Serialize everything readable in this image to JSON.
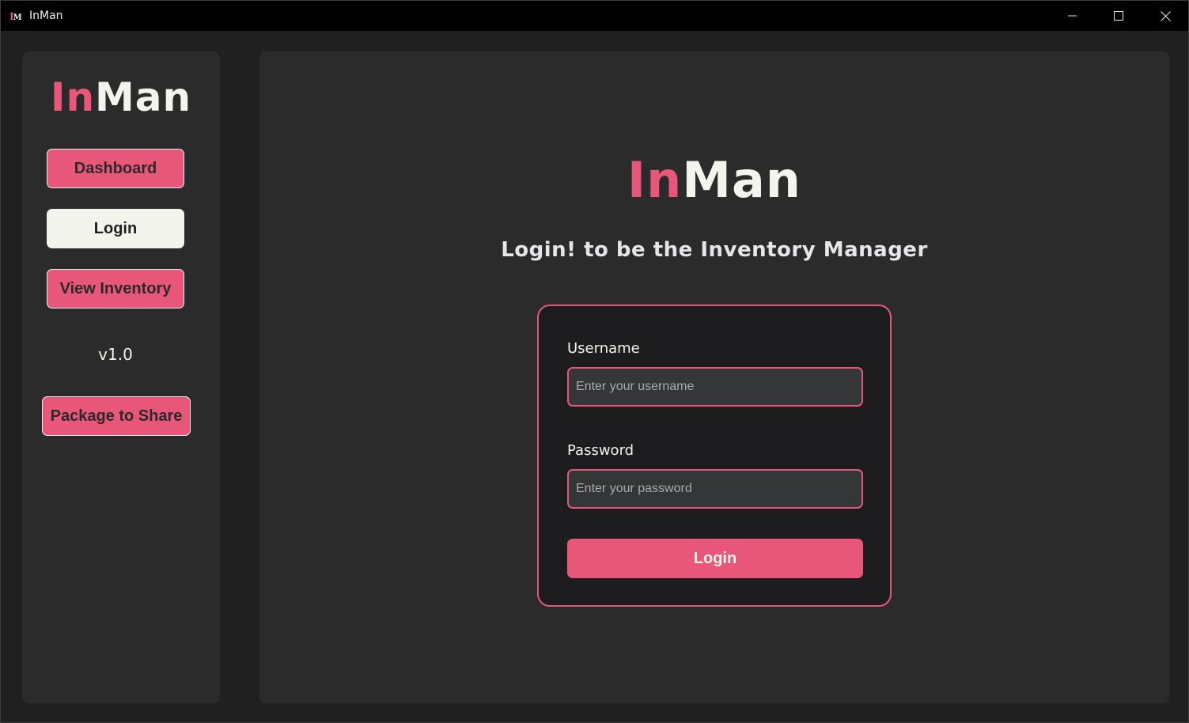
{
  "window": {
    "title": "InMan",
    "icon_letters": {
      "first": "I",
      "second": "M"
    },
    "controls": [
      {
        "name": "minimize",
        "icon": "minimize-icon"
      },
      {
        "name": "maximize",
        "icon": "maximize-icon"
      },
      {
        "name": "close",
        "icon": "close-icon"
      }
    ]
  },
  "brand": {
    "part1": "In",
    "part2": "Man",
    "accent_color": "#e8577a",
    "light_color": "#f3f4ec"
  },
  "sidebar": {
    "nav": {
      "dashboard": "Dashboard",
      "login": "Login",
      "view_inventory": "View Inventory"
    },
    "active_item": "login",
    "version": "v1.0",
    "package_button": "Package to Share"
  },
  "main": {
    "subtitle": "Login! to be the Inventory Manager",
    "form": {
      "username_label": "Username",
      "username_placeholder": "Enter your username",
      "username_value": "",
      "password_label": "Password",
      "password_placeholder": "Enter your password",
      "password_value": "",
      "submit_label": "Login"
    }
  }
}
